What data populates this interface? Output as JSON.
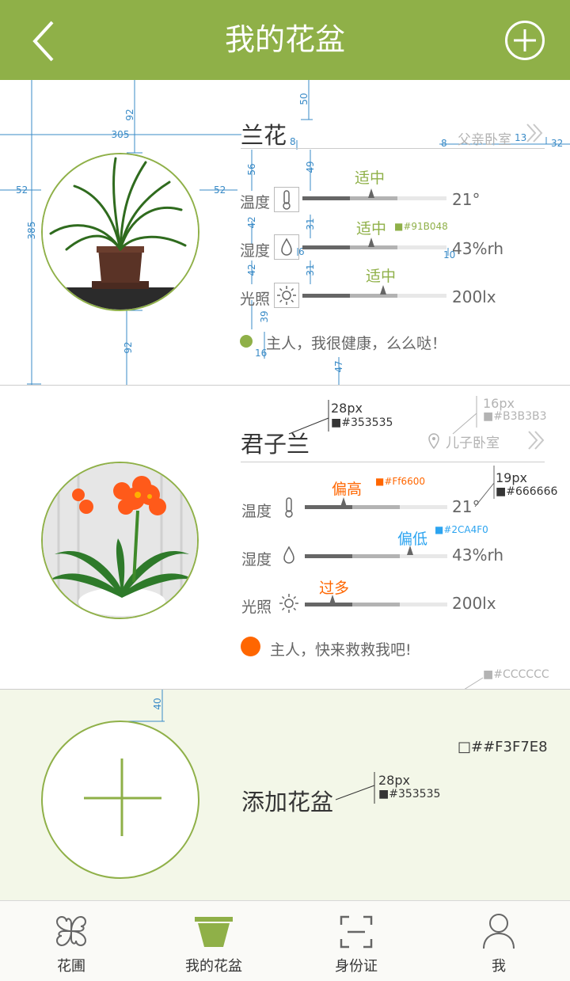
{
  "header": {
    "title": "我的花盆",
    "back_icon": "chevron-left-icon",
    "add_icon": "plus-circle-icon",
    "bg_color": "#91B048"
  },
  "plants": [
    {
      "name": "兰花",
      "location": "父亲卧室",
      "rows": [
        {
          "label": "温度",
          "icon": "thermometer-icon",
          "status": "适中",
          "status_color": "#91B048",
          "value": "21°",
          "level": 0.45
        },
        {
          "label": "湿度",
          "icon": "water-drop-icon",
          "status": "适中",
          "status_color": "#91B048",
          "value": "43%rh",
          "level": 0.45
        },
        {
          "label": "光照",
          "icon": "sun-icon",
          "status": "适中",
          "status_color": "#91B048",
          "value": "200lx",
          "level": 0.55
        }
      ],
      "message": "主人，我很健康，么么哒！",
      "message_dot_color": "#91B048"
    },
    {
      "name": "君子兰",
      "location": "儿子卧室",
      "rows": [
        {
          "label": "温度",
          "icon": "thermometer-icon",
          "status": "偏高",
          "status_color": "#FF6600",
          "value": "21°",
          "level": 0.27
        },
        {
          "label": "湿度",
          "icon": "water-drop-icon",
          "status": "偏低",
          "status_color": "#2CA4F0",
          "value": "43%rh",
          "level": 0.74
        },
        {
          "label": "光照",
          "icon": "sun-icon",
          "status": "过多",
          "status_color": "#FF6600",
          "value": "200lx",
          "level": 0.19
        }
      ],
      "message": "主人，快来救救我吧!",
      "message_dot_color": "#FF6600"
    }
  ],
  "add_pot": {
    "label": "添加花盆",
    "icon": "plus-icon"
  },
  "annotations": {
    "dims": [
      "50",
      "92",
      "305",
      "8",
      "13",
      "32",
      "8",
      "56",
      "49",
      "52",
      "52",
      "385",
      "42",
      "31",
      "6",
      "10",
      "42",
      "31",
      "39",
      "16",
      "92",
      "47",
      "40"
    ],
    "swatch_green": "#91B048",
    "title_size": "28px",
    "title_color": "#353535",
    "loc_size": "16px",
    "loc_color": "#B3B3B3",
    "val_size": "19px",
    "val_color": "#666666",
    "orange": "#Ff6600",
    "blue": "#2CA4F0",
    "sep_color": "#CCCCCC",
    "bg_color": "##F3F7E8",
    "add_size": "28px",
    "add_color": "#353535"
  },
  "nav": [
    {
      "label": "花圃",
      "icon": "clover-icon"
    },
    {
      "label": "我的花盆",
      "icon": "flower-pot-icon"
    },
    {
      "label": "身份证",
      "icon": "scan-frame-icon"
    },
    {
      "label": "我",
      "icon": "user-icon"
    }
  ]
}
